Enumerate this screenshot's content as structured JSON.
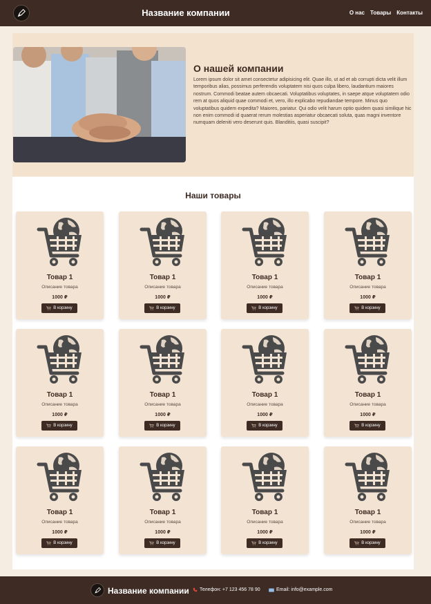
{
  "header": {
    "brand": "Название компании",
    "nav": [
      "О нас",
      "Товары",
      "Контакты"
    ]
  },
  "about": {
    "title": "О нашей компании",
    "text": "Lorem ipsum dolor sit amet consectetur adipisicing elit. Quae illo, ut ad et ab corrupti dicta velit illum temporibus alias, possimus perferendis voluptatem nisi quos culpa libero, laudantium maiores nostrum. Commodi beatae autem obcaecati. Voluptatibus voluptates, in saepe atque voluptatem odio rem at quos aliquid quae commodi et, vero, illo explicabo repudiandae tempore. Minus quo voluptatibus quidem expedita? Maiores, pariatur. Qui odio velit harum optio quidem quasi similique hic non enim commodi id quaerat rerum molestias asperiatur obcaecati soluta, quas magni inventore numquam deleniti vero deserunt quis. Blanditiis, quasi suscipit?",
    "image": "team-hands-photo"
  },
  "products": {
    "title": "Наши товары",
    "items": [
      {
        "name": "Товар 1",
        "desc": "Описание товара",
        "price": "1000 ₽",
        "button": "В корзину"
      },
      {
        "name": "Товар 1",
        "desc": "Описание товара",
        "price": "1000 ₽",
        "button": "В корзину"
      },
      {
        "name": "Товар 1",
        "desc": "Описание товара",
        "price": "1000 ₽",
        "button": "В корзину"
      },
      {
        "name": "Товар 1",
        "desc": "Описание товара",
        "price": "1000 ₽",
        "button": "В корзину"
      },
      {
        "name": "Товар 1",
        "desc": "Описание товара",
        "price": "1000 ₽",
        "button": "В корзину"
      },
      {
        "name": "Товар 1",
        "desc": "Описание товара",
        "price": "1000 ₽",
        "button": "В корзину"
      },
      {
        "name": "Товар 1",
        "desc": "Описание товара",
        "price": "1000 ₽",
        "button": "В корзину"
      },
      {
        "name": "Товар 1",
        "desc": "Описание товара",
        "price": "1000 ₽",
        "button": "В корзину"
      },
      {
        "name": "Товар 1",
        "desc": "Описание товара",
        "price": "1000 ₽",
        "button": "В корзину"
      },
      {
        "name": "Товар 1",
        "desc": "Описание товара",
        "price": "1000 ₽",
        "button": "В корзину"
      },
      {
        "name": "Товар 1",
        "desc": "Описание товара",
        "price": "1000 ₽",
        "button": "В корзину"
      },
      {
        "name": "Товар 1",
        "desc": "Описание товара",
        "price": "1000 ₽",
        "button": "В корзину"
      }
    ]
  },
  "footer": {
    "brand": "Название компании",
    "phone": "Телефон: +7 123 456 78 90",
    "email": "Email: info@example.com"
  },
  "colors": {
    "header_bg": "#3d2b24",
    "page_bg": "#f5ede1",
    "about_bg": "#f3e2cd",
    "card_bg": "#f3e3d3"
  },
  "icons": {
    "logo": "pen-nib-icon",
    "product": "globe-cart-icon",
    "cart_button": "cart-icon",
    "phone": "phone-icon",
    "email": "envelope-icon"
  }
}
